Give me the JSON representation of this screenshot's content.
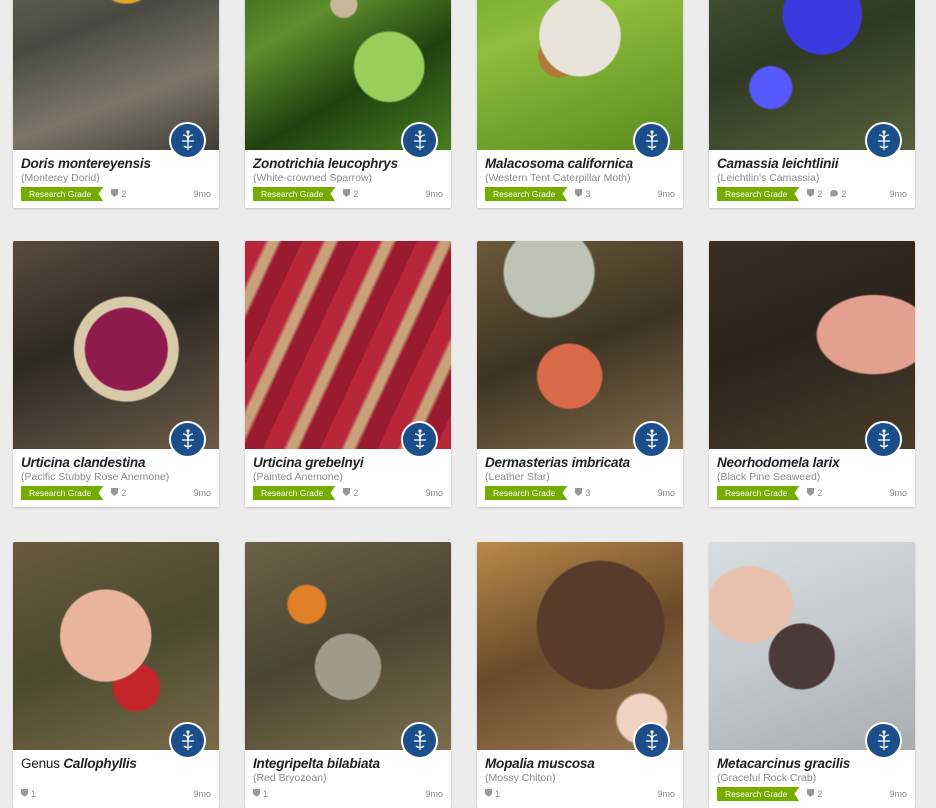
{
  "badge_icon": "inaturalist-logo-icon",
  "colors": {
    "research_grade": "#74ac00",
    "badge_bg": "#1b4e8a",
    "page_bg": "#ececec"
  },
  "observations": [
    {
      "scientific": "Doris montereyensis",
      "rank": "",
      "common": "(Monterey Dorid)",
      "grade": "Research Grade",
      "ids": "2",
      "comments": "",
      "age": "9mo"
    },
    {
      "scientific": "Zonotrichia leucophrys",
      "rank": "",
      "common": "(White-crowned Sparrow)",
      "grade": "Research Grade",
      "ids": "2",
      "comments": "",
      "age": "9mo"
    },
    {
      "scientific": "Malacosoma californica",
      "rank": "",
      "common": "(Western Tent Caterpillar Moth)",
      "grade": "Research Grade",
      "ids": "3",
      "comments": "",
      "age": "9mo"
    },
    {
      "scientific": "Camassia leichtlinii",
      "rank": "",
      "common": "(Leichtlin's Camassia)",
      "grade": "Research Grade",
      "ids": "2",
      "comments": "2",
      "age": "9mo"
    },
    {
      "scientific": "Urticina clandestina",
      "rank": "",
      "common": "(Pacific Stubby Rose Anemone)",
      "grade": "Research Grade",
      "ids": "2",
      "comments": "",
      "age": "9mo"
    },
    {
      "scientific": "Urticina grebelnyi",
      "rank": "",
      "common": "(Painted Anemone)",
      "grade": "Research Grade",
      "ids": "2",
      "comments": "",
      "age": "9mo"
    },
    {
      "scientific": "Dermasterias imbricata",
      "rank": "",
      "common": "(Leather Star)",
      "grade": "Research Grade",
      "ids": "3",
      "comments": "",
      "age": "9mo"
    },
    {
      "scientific": "Neorhodomela larix",
      "rank": "",
      "common": "(Black Pine Seaweed)",
      "grade": "Research Grade",
      "ids": "2",
      "comments": "",
      "age": "9mo"
    },
    {
      "scientific": "Callophyllis",
      "rank": "Genus",
      "common": "",
      "grade": "",
      "ids": "1",
      "comments": "",
      "age": "9mo"
    },
    {
      "scientific": "Integripelta bilabiata",
      "rank": "",
      "common": "(Red Bryozoan)",
      "grade": "",
      "ids": "1",
      "comments": "",
      "age": "9mo"
    },
    {
      "scientific": "Mopalia muscosa",
      "rank": "",
      "common": "(Mossy Chiton)",
      "grade": "",
      "ids": "1",
      "comments": "",
      "age": "9mo"
    },
    {
      "scientific": "Metacarcinus gracilis",
      "rank": "",
      "common": "(Graceful Rock Crab)",
      "grade": "Research Grade",
      "ids": "2",
      "comments": "",
      "age": "9mo"
    }
  ]
}
